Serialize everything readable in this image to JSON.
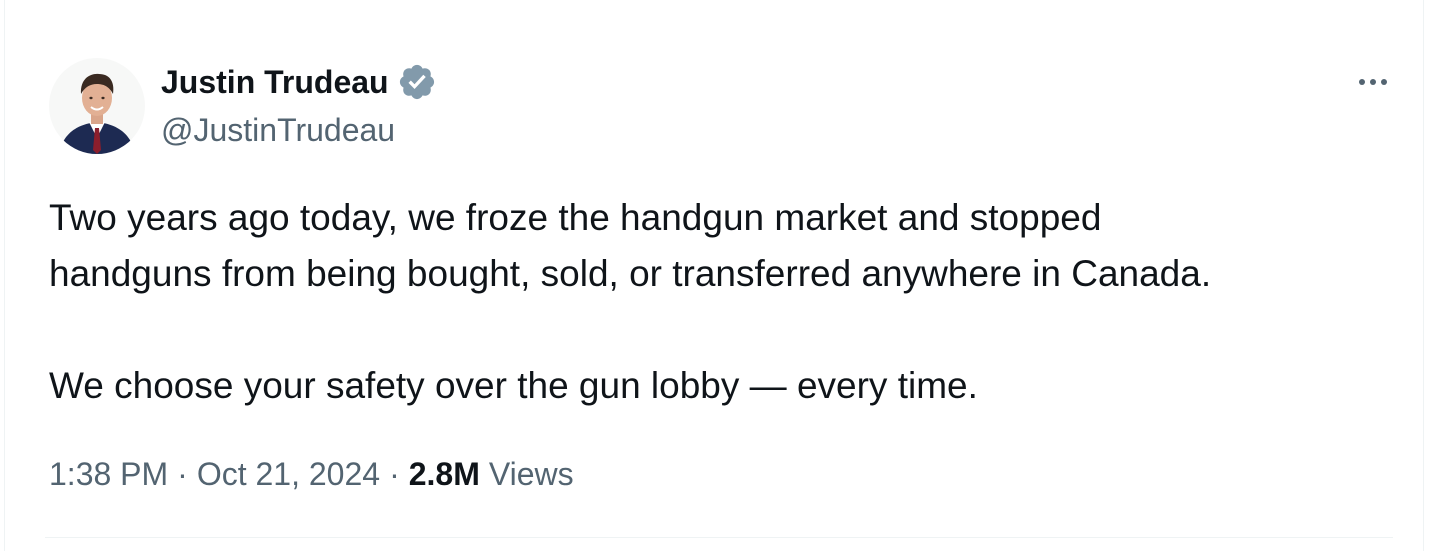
{
  "author": {
    "display_name": "Justin Trudeau",
    "handle": "@JustinTrudeau",
    "verified_badge_color": "#829aab",
    "verified_icon": "verified-badge-icon",
    "avatar_icon": "profile-photo"
  },
  "tweet": {
    "text": "Two years ago today, we froze the handgun market and stopped\nhandguns from being bought, sold, or transferred anywhere in Canada.\n\nWe choose your safety over the gun lobby — every time."
  },
  "meta": {
    "time": "1:38 PM",
    "separator": "·",
    "date": "Oct 21, 2024",
    "views_count": "2.8M",
    "views_label": "Views"
  },
  "actions": {
    "more_icon": "more-options-icon"
  },
  "colors": {
    "text_primary": "#0f1419",
    "text_secondary": "#536471",
    "border": "#eff3f4"
  }
}
